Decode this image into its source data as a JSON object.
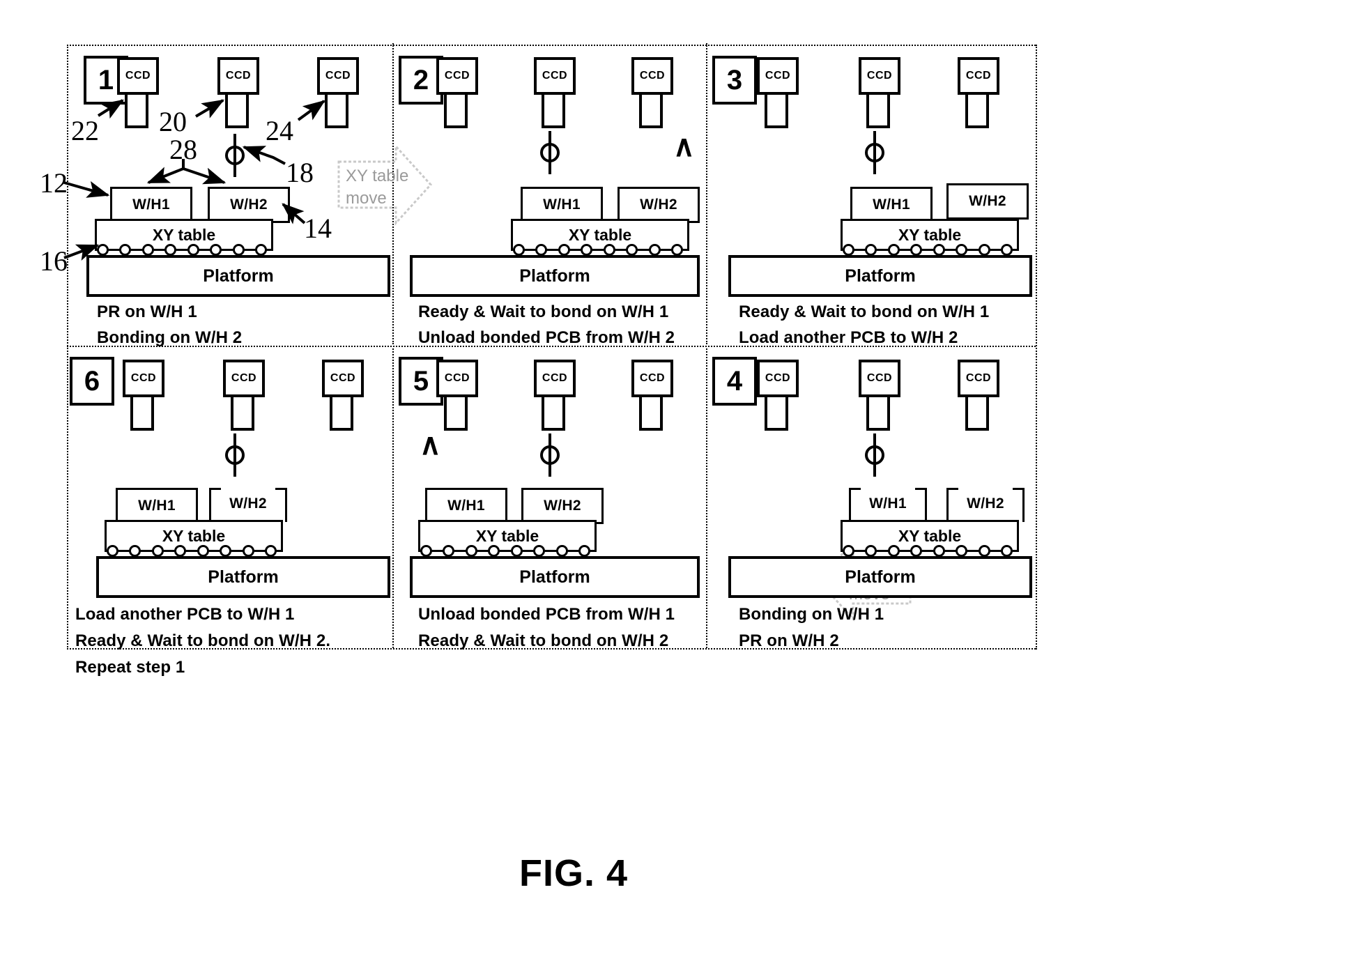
{
  "figure": {
    "title": "FIG. 4"
  },
  "labels": {
    "ccd": "CCD",
    "wh1": "W/H1",
    "wh2": "W/H2",
    "xy_table": "XY table",
    "platform": "Platform",
    "move_arrow": "XY table\nmove",
    "move_arrow_line1": "XY table",
    "move_arrow_line2": "move",
    "chevron": "∧"
  },
  "callouts": [
    {
      "id": "22",
      "text": "22"
    },
    {
      "id": "20",
      "text": "20"
    },
    {
      "id": "24",
      "text": "24"
    },
    {
      "id": "28",
      "text": "28"
    },
    {
      "id": "18",
      "text": "18"
    },
    {
      "id": "12",
      "text": "12"
    },
    {
      "id": "14",
      "text": "14"
    },
    {
      "id": "16",
      "text": "16"
    }
  ],
  "panels": [
    {
      "number": "1",
      "wh1_state": "boxed",
      "wh2_state": "boxed",
      "caption": [
        "PR on W/H 1",
        "Bonding on W/H 2"
      ]
    },
    {
      "number": "2",
      "wh1_state": "boxed",
      "wh2_state": "boxed",
      "caption": [
        "Ready & Wait to bond on W/H 1",
        "Unload bonded PCB from W/H 2"
      ]
    },
    {
      "number": "3",
      "wh1_state": "boxed",
      "wh2_state": "boxed",
      "caption": [
        "Ready & Wait to bond on W/H 1",
        "Load another PCB to W/H 2"
      ]
    },
    {
      "number": "6",
      "wh1_state": "boxed",
      "wh2_state": "bracket",
      "caption": [
        "Load another PCB to W/H 1",
        "Ready & Wait to bond on W/H 2.",
        "Repeat step 1"
      ]
    },
    {
      "number": "5",
      "wh1_state": "boxed",
      "wh2_state": "boxed",
      "caption": [
        "Unload bonded PCB from W/H 1",
        "Ready & Wait to bond on W/H 2"
      ]
    },
    {
      "number": "4",
      "wh1_state": "bracket",
      "wh2_state": "bracket",
      "caption": [
        "Bonding on W/H 1",
        "PR on W/H 2"
      ]
    }
  ],
  "colors": {
    "ink": "#000000",
    "ghost": "#9a9a9a",
    "paper": "#ffffff"
  }
}
